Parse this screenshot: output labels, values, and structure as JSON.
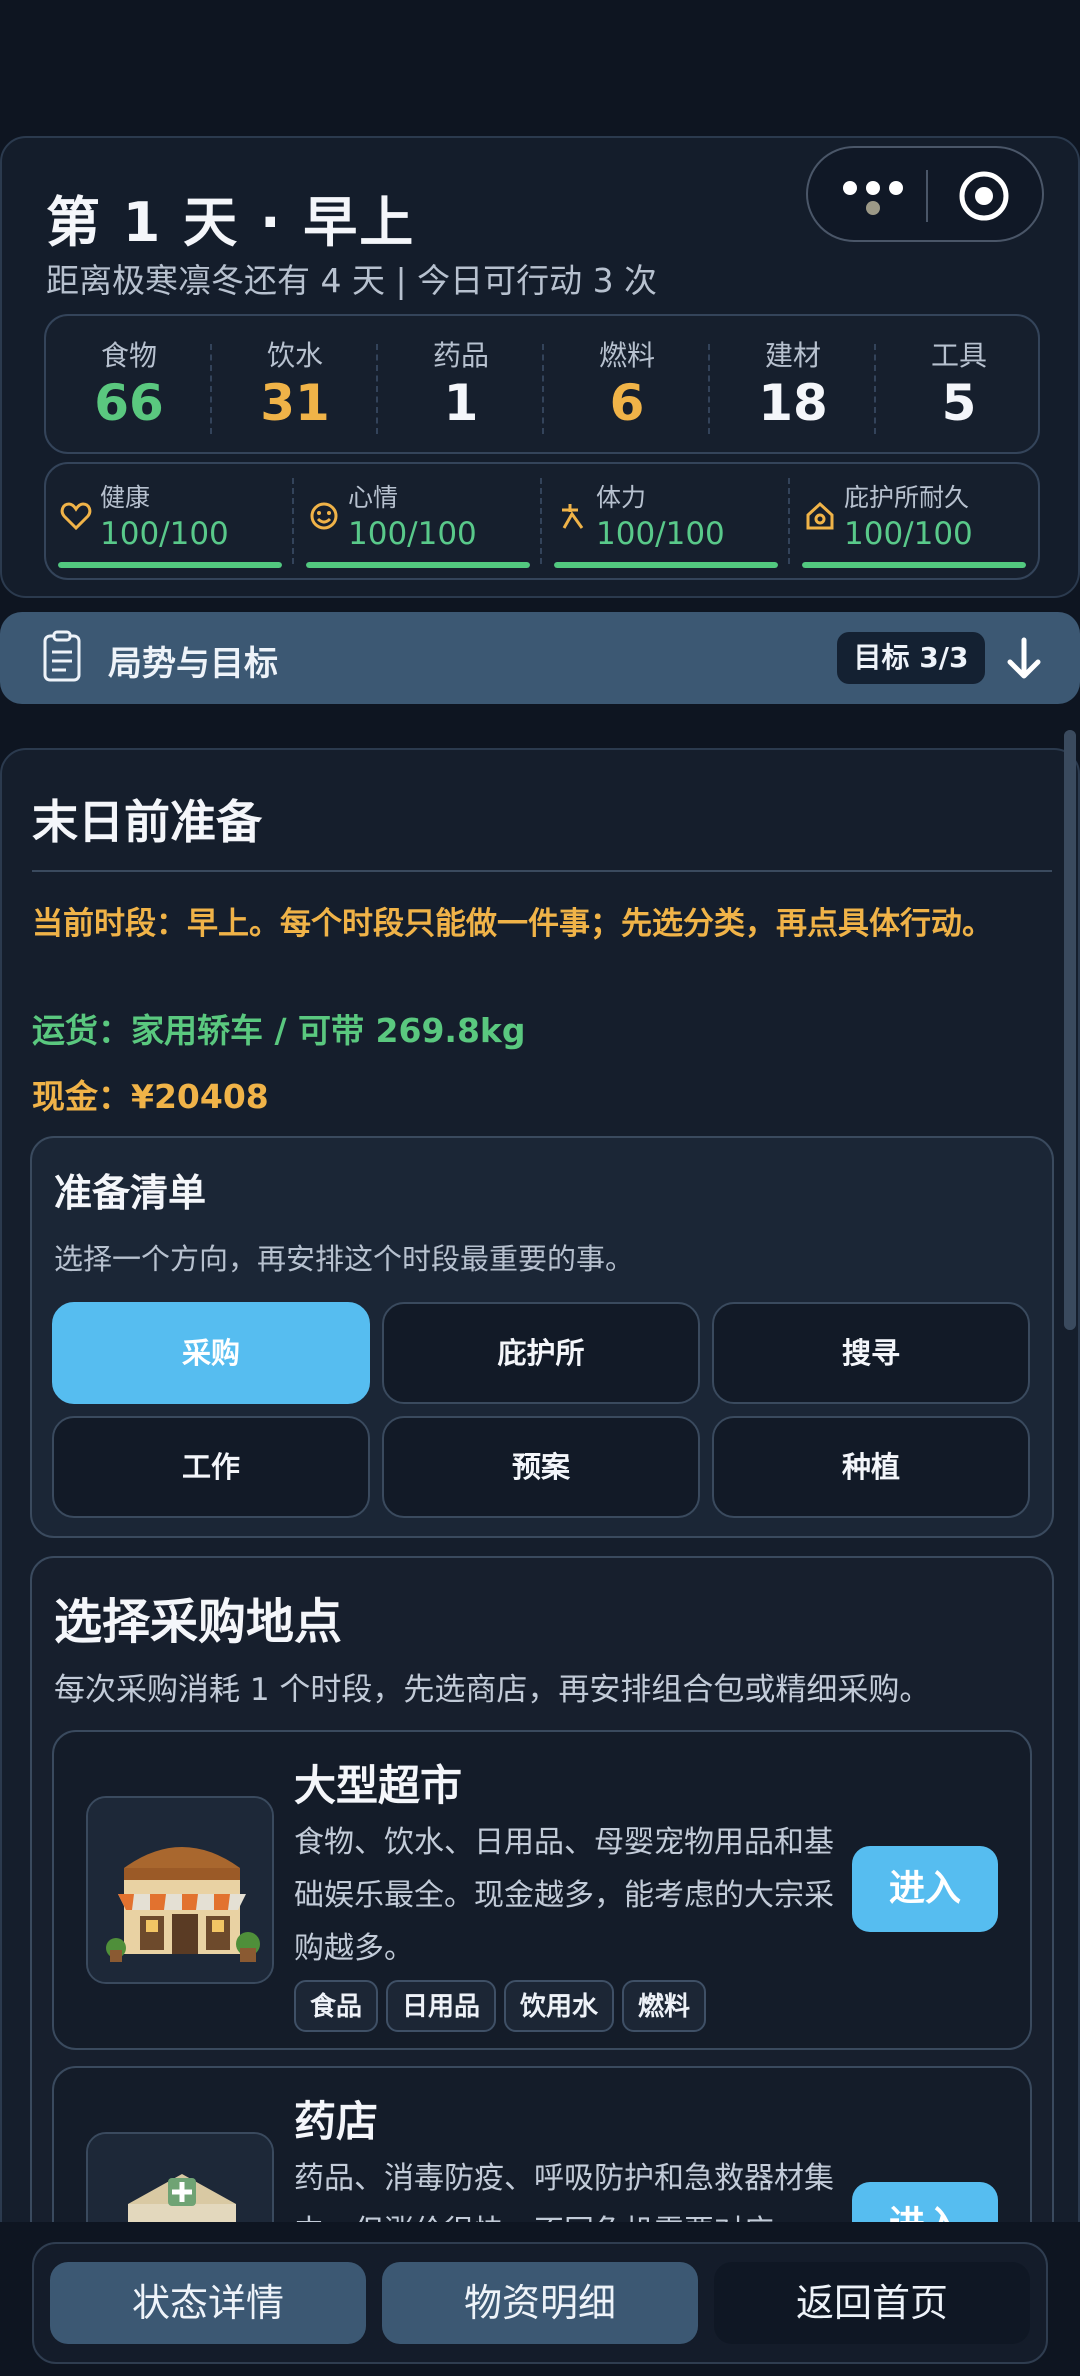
{
  "header": {
    "day_title": "第 1 天 · 早上",
    "subtitle": "距离极寒凛冬还有 4 天 | 今日可行动 3 次",
    "resources": [
      {
        "label": "食物",
        "value": "66",
        "color": "#5ac87f"
      },
      {
        "label": "饮水",
        "value": "31",
        "color": "#f0b348"
      },
      {
        "label": "药品",
        "value": "1",
        "color": "#f4f6fa"
      },
      {
        "label": "燃料",
        "value": "6",
        "color": "#f0b348"
      },
      {
        "label": "建材",
        "value": "18",
        "color": "#f4f6fa"
      },
      {
        "label": "工具",
        "value": "5",
        "color": "#f4f6fa"
      }
    ],
    "stats": [
      {
        "label": "健康",
        "value": "100/100",
        "icon": "heart-icon",
        "level": 1.0
      },
      {
        "label": "心情",
        "value": "100/100",
        "icon": "smile-icon",
        "level": 1.0
      },
      {
        "label": "体力",
        "value": "100/100",
        "icon": "stamina-icon",
        "level": 1.0
      },
      {
        "label": "庇护所耐久",
        "value": "100/100",
        "icon": "house-icon",
        "level": 1.0
      }
    ]
  },
  "goals_bar": {
    "title": "局势与目标",
    "badge": "目标 3/3"
  },
  "main": {
    "title": "末日前准备",
    "notice": "当前时段：早上。每个时段只能做一件事；先选分类，再点具体行动。",
    "cargo": "运货：家用轿车 / 可带 269.8kg",
    "cash": "现金：¥20408",
    "prep": {
      "title": "准备清单",
      "subtitle": "选择一个方向，再安排这个时段最重要的事。",
      "categories": [
        "采购",
        "庇护所",
        "搜寻",
        "工作",
        "预案",
        "种植"
      ],
      "active": "采购"
    },
    "shops": {
      "title": "选择采购地点",
      "subtitle": "每次采购消耗 1 个时段，先选商店，再安排组合包或精细采购。",
      "items": [
        {
          "name": "大型超市",
          "desc": "食物、饮水、日用品、母婴宠物用品和基础娱乐最全。现金越多，能考虑的大宗采购越多。",
          "tags": [
            "食品",
            "日用品",
            "饮用水",
            "燃料"
          ],
          "button": "进入"
        },
        {
          "name": "药店",
          "desc": "药品、消毒防疫、呼吸防护和急救器材集中，但涨价很快，不同危机需要对应",
          "tags": [],
          "button": "进入"
        }
      ]
    }
  },
  "bottom_nav": [
    "状态详情",
    "物资明细",
    "返回首页"
  ]
}
